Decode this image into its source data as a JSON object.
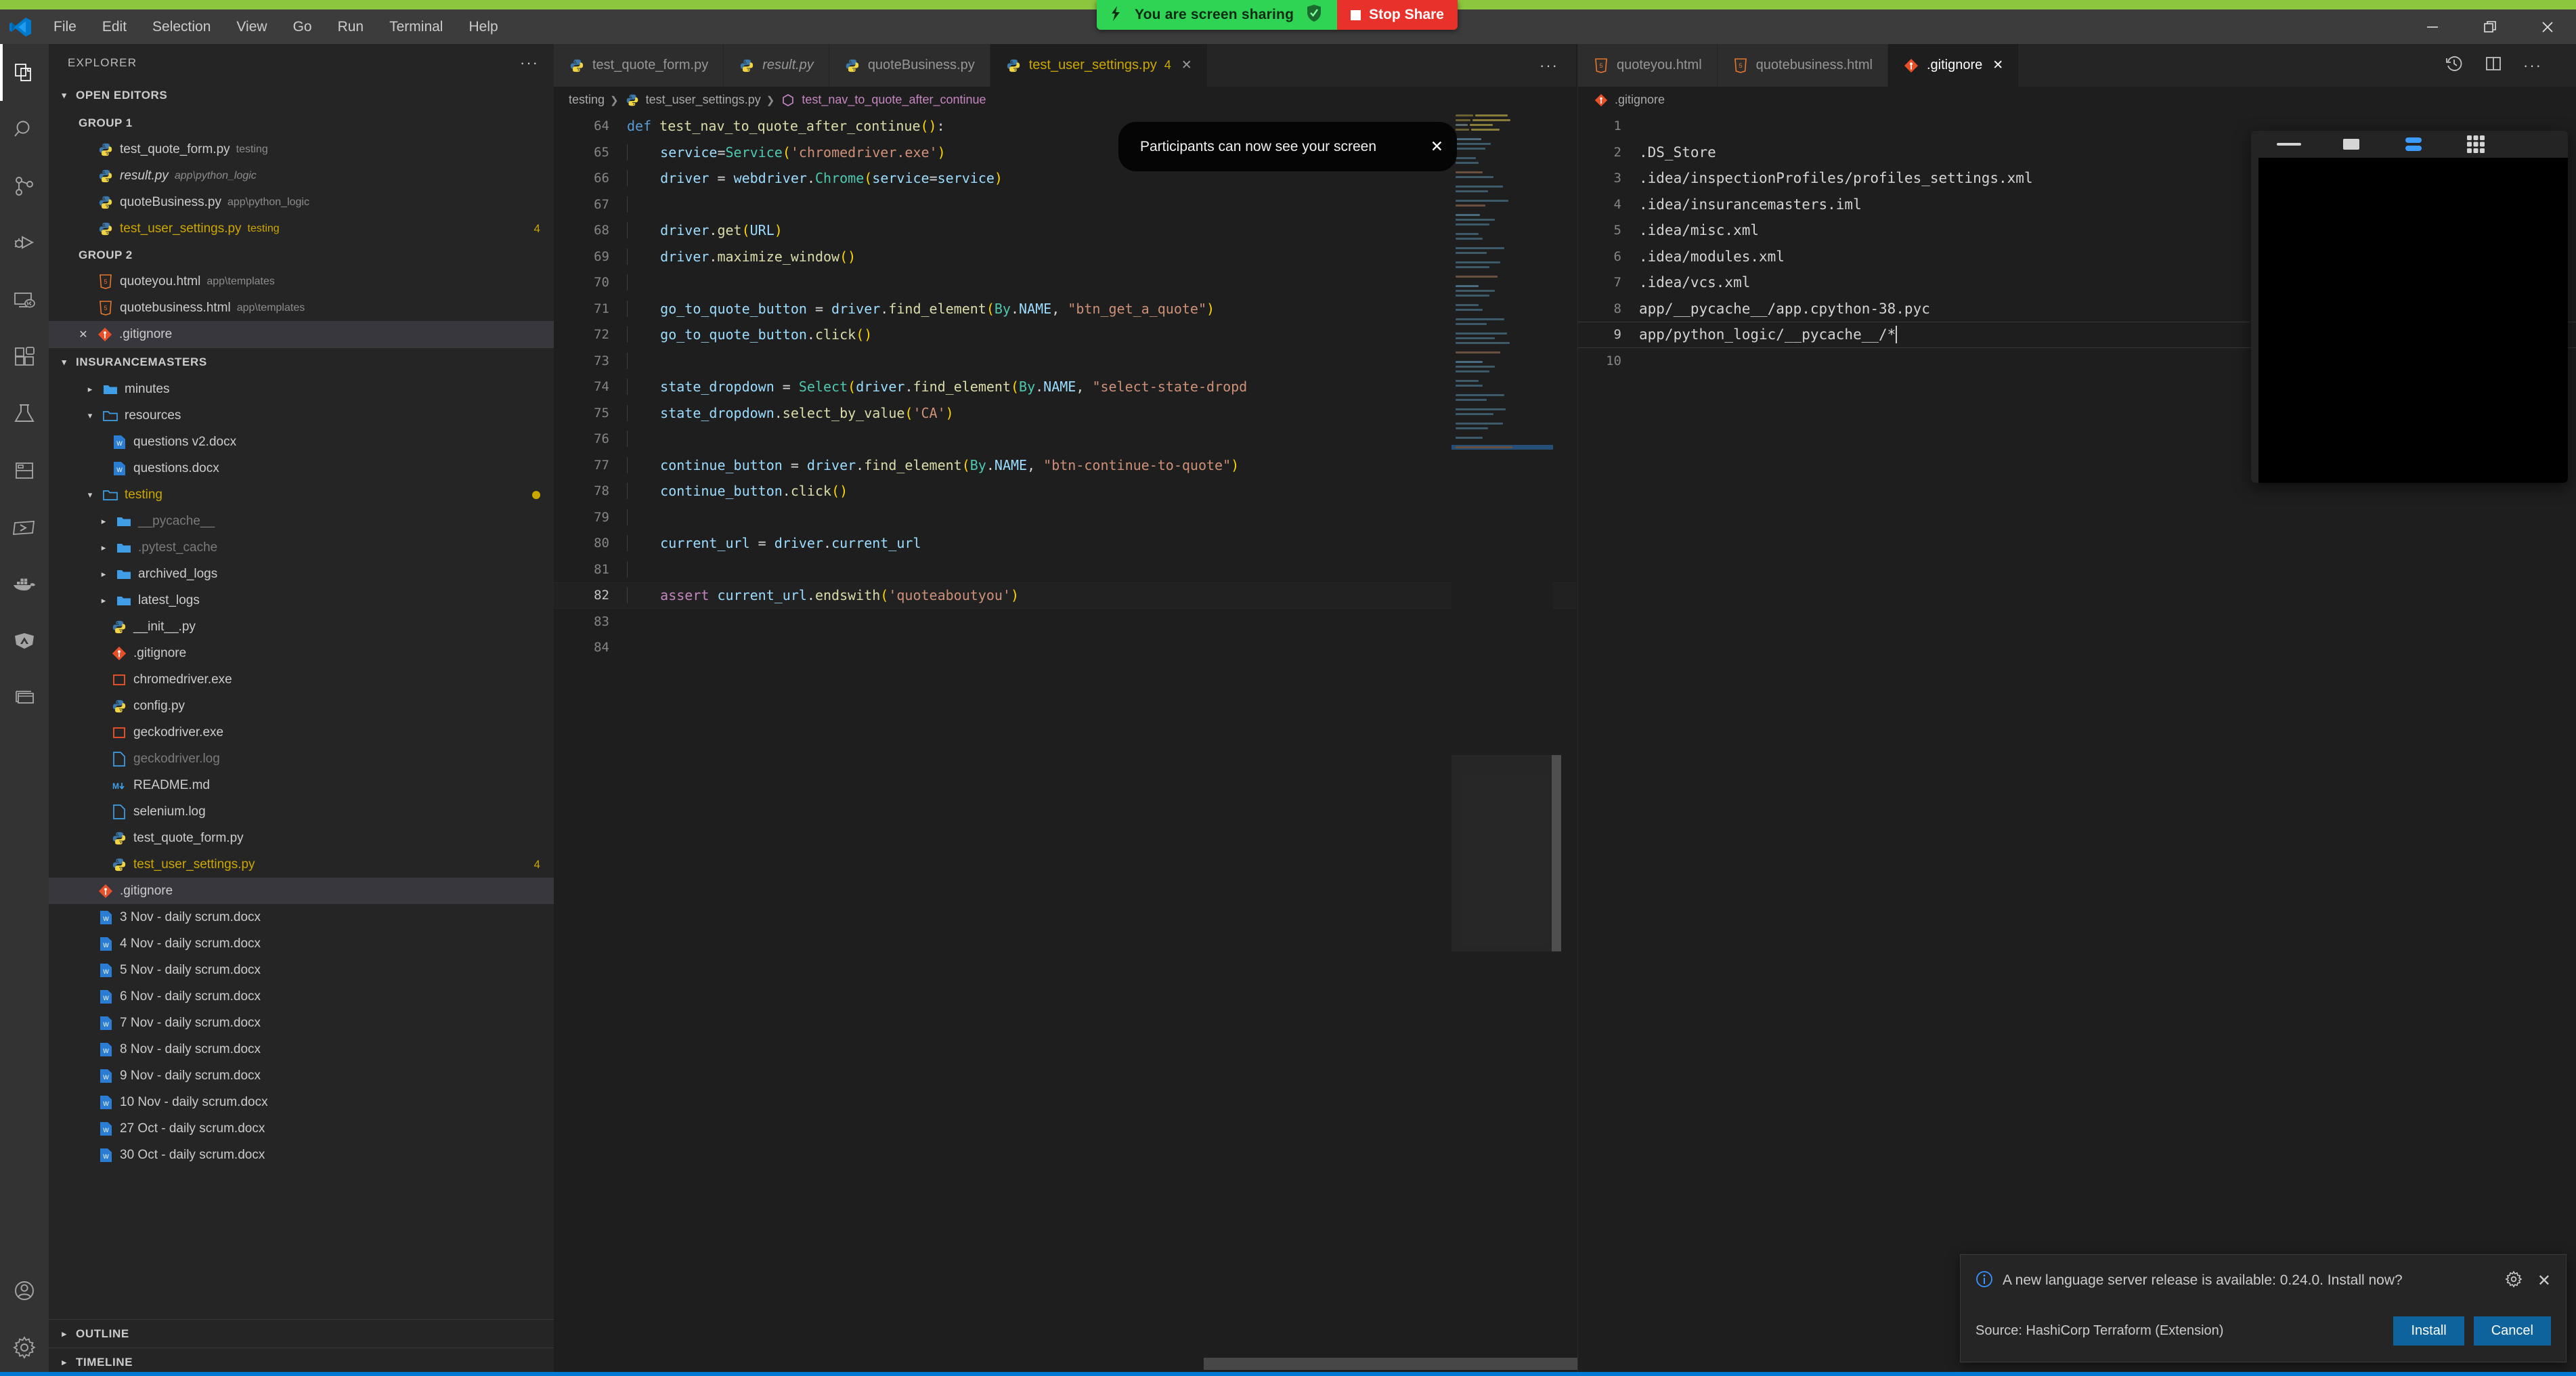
{
  "share_banner": {
    "message": "You are screen sharing",
    "stop_label": "Stop Share",
    "share_bg": "#2fd455",
    "stop_bg": "#e8312a",
    "strip_color": "#8cc63f"
  },
  "titlebar": {
    "menus": [
      "File",
      "Edit",
      "Selection",
      "View",
      "Go",
      "Run",
      "Terminal",
      "Help"
    ],
    "minimize": "—",
    "restore": "❐",
    "close": "✕"
  },
  "activity_bar": {
    "items": [
      {
        "name": "explorer",
        "icon": "files-icon",
        "active": true
      },
      {
        "name": "search",
        "icon": "search-icon",
        "active": false
      },
      {
        "name": "source-control",
        "icon": "source-control-icon",
        "active": false
      },
      {
        "name": "run-and-debug",
        "icon": "debug-icon",
        "active": false
      },
      {
        "name": "remote-explorer",
        "icon": "remote-icon",
        "active": false
      },
      {
        "name": "extensions",
        "icon": "extensions-icon",
        "active": false
      },
      {
        "name": "testing",
        "icon": "beaker-icon",
        "active": false
      },
      {
        "name": "live-server",
        "icon": "preview-icon",
        "active": false
      },
      {
        "name": "azure",
        "icon": "terminal-azure-icon",
        "active": false
      },
      {
        "name": "docker",
        "icon": "docker-icon",
        "active": false
      },
      {
        "name": "atlassian",
        "icon": "atlassian-icon",
        "active": false
      },
      {
        "name": "database",
        "icon": "database-icon",
        "active": false
      }
    ],
    "bottom": [
      {
        "name": "accounts",
        "icon": "account-icon"
      },
      {
        "name": "settings",
        "icon": "gear-icon"
      }
    ]
  },
  "sidebar": {
    "title": "EXPLORER",
    "more_label": "···",
    "open_editors": {
      "label": "OPEN EDITORS",
      "groups": [
        {
          "label": "GROUP 1",
          "items": [
            {
              "name": "test_quote_form.py",
              "desc": "testing",
              "icon": "python-icon",
              "badge": "",
              "state": ""
            },
            {
              "name": "result.py",
              "desc": "app\\python_logic",
              "icon": "python-icon",
              "badge": "",
              "state": "italic"
            },
            {
              "name": "quoteBusiness.py",
              "desc": "app\\python_logic",
              "icon": "python-icon",
              "badge": "",
              "state": ""
            },
            {
              "name": "test_user_settings.py",
              "desc": "testing",
              "icon": "python-icon",
              "badge": "4",
              "state": "warn"
            }
          ]
        },
        {
          "label": "GROUP 2",
          "items": [
            {
              "name": "quoteyou.html",
              "desc": "app\\templates",
              "icon": "html-icon",
              "badge": "",
              "state": ""
            },
            {
              "name": "quotebusiness.html",
              "desc": "app\\templates",
              "icon": "html-icon",
              "badge": "",
              "state": ""
            },
            {
              "name": ".gitignore",
              "desc": "",
              "icon": "git-icon",
              "badge": "",
              "state": "selected",
              "close": "✕"
            }
          ]
        }
      ]
    },
    "workspace": {
      "label": "INSURANCEMASTERS",
      "items": [
        {
          "name": "minutes",
          "type": "folder",
          "expanded": false,
          "indent": 1
        },
        {
          "name": "resources",
          "type": "folder-open",
          "expanded": true,
          "indent": 1
        },
        {
          "name": "questions v2.docx",
          "type": "word",
          "indent": 2
        },
        {
          "name": "questions.docx",
          "type": "word",
          "indent": 2
        },
        {
          "name": "testing",
          "type": "folder-open",
          "expanded": true,
          "indent": 1,
          "state": "warn",
          "dot": true
        },
        {
          "name": "__pycache__",
          "type": "folder",
          "expanded": false,
          "indent": 2,
          "state": "dim"
        },
        {
          "name": ".pytest_cache",
          "type": "folder",
          "expanded": false,
          "indent": 2,
          "state": "dim"
        },
        {
          "name": "archived_logs",
          "type": "folder",
          "expanded": false,
          "indent": 2
        },
        {
          "name": "latest_logs",
          "type": "folder",
          "expanded": false,
          "indent": 2
        },
        {
          "name": "__init__.py",
          "type": "python",
          "indent": 3
        },
        {
          "name": ".gitignore",
          "type": "git",
          "indent": 3
        },
        {
          "name": "chromedriver.exe",
          "type": "exe",
          "indent": 3
        },
        {
          "name": "config.py",
          "type": "python",
          "indent": 3
        },
        {
          "name": "geckodriver.exe",
          "type": "exe",
          "indent": 3
        },
        {
          "name": "geckodriver.log",
          "type": "log",
          "indent": 3,
          "state": "dim"
        },
        {
          "name": "README.md",
          "type": "markdown",
          "indent": 3
        },
        {
          "name": "selenium.log",
          "type": "log",
          "indent": 3
        },
        {
          "name": "test_quote_form.py",
          "type": "python",
          "indent": 3
        },
        {
          "name": "test_user_settings.py",
          "type": "python",
          "indent": 3,
          "state": "warn",
          "badge": "4"
        },
        {
          "name": ".gitignore",
          "type": "git",
          "indent": 2,
          "state": "selected"
        },
        {
          "name": "3 Nov - daily scrum.docx",
          "type": "word",
          "indent": 2
        },
        {
          "name": "4 Nov - daily scrum.docx",
          "type": "word",
          "indent": 2
        },
        {
          "name": "5 Nov - daily scrum.docx",
          "type": "word",
          "indent": 2
        },
        {
          "name": "6 Nov - daily scrum.docx",
          "type": "word",
          "indent": 2
        },
        {
          "name": "7 Nov - daily scrum.docx",
          "type": "word",
          "indent": 2
        },
        {
          "name": "8 Nov - daily scrum.docx",
          "type": "word",
          "indent": 2
        },
        {
          "name": "9 Nov - daily scrum.docx",
          "type": "word",
          "indent": 2
        },
        {
          "name": "10 Nov - daily scrum.docx",
          "type": "word",
          "indent": 2
        },
        {
          "name": "27 Oct - daily scrum.docx",
          "type": "word",
          "indent": 2
        },
        {
          "name": "30 Oct - daily scrum.docx",
          "type": "word",
          "indent": 2
        }
      ]
    },
    "outline_label": "OUTLINE",
    "timeline_label": "TIMELINE"
  },
  "editor_group_1": {
    "tabs": [
      {
        "label": "test_quote_form.py",
        "icon": "python-icon",
        "active": false,
        "italic": false,
        "count": "",
        "close": ""
      },
      {
        "label": "result.py",
        "icon": "python-icon",
        "active": false,
        "italic": true,
        "count": "",
        "close": ""
      },
      {
        "label": "quoteBusiness.py",
        "icon": "python-icon",
        "active": false,
        "italic": false,
        "count": "",
        "close": ""
      },
      {
        "label": "test_user_settings.py",
        "icon": "python-icon",
        "active": true,
        "italic": false,
        "count": "4",
        "close": "✕"
      }
    ],
    "more_label": "···",
    "breadcrumb": [
      "testing",
      "test_user_settings.py",
      "test_nav_to_quote_after_continue"
    ],
    "first_line_number": 64,
    "active_line": 82,
    "lines": [
      {
        "n": 64,
        "text": "def test_nav_to_quote_after_continue():"
      },
      {
        "n": 65,
        "text": "    service=Service('chromedriver.exe')"
      },
      {
        "n": 66,
        "text": "    driver = webdriver.Chrome(service=service)"
      },
      {
        "n": 67,
        "text": ""
      },
      {
        "n": 68,
        "text": "    driver.get(URL)"
      },
      {
        "n": 69,
        "text": "    driver.maximize_window()"
      },
      {
        "n": 70,
        "text": ""
      },
      {
        "n": 71,
        "text": "    go_to_quote_button = driver.find_element(By.NAME, \"btn_get_a_quote\")"
      },
      {
        "n": 72,
        "text": "    go_to_quote_button.click()"
      },
      {
        "n": 73,
        "text": ""
      },
      {
        "n": 74,
        "text": "    state_dropdown = Select(driver.find_element(By.NAME, \"select-state-dropdown\"))"
      },
      {
        "n": 75,
        "text": "    state_dropdown.select_by_value('CA')"
      },
      {
        "n": 76,
        "text": ""
      },
      {
        "n": 77,
        "text": "    continue_button = driver.find_element(By.NAME, \"btn-continue-to-quote\")"
      },
      {
        "n": 78,
        "text": "    continue_button.click()"
      },
      {
        "n": 79,
        "text": ""
      },
      {
        "n": 80,
        "text": "    current_url = driver.current_url"
      },
      {
        "n": 81,
        "text": ""
      },
      {
        "n": 82,
        "text": "    assert current_url.endswith('quoteaboutyou')"
      },
      {
        "n": 83,
        "text": ""
      },
      {
        "n": 84,
        "text": ""
      }
    ]
  },
  "tooltip": {
    "message": "Participants can now see your screen",
    "close": "✕"
  },
  "editor_group_2": {
    "tabs": [
      {
        "label": "quoteyou.html",
        "icon": "html-icon",
        "active": false,
        "close": ""
      },
      {
        "label": "quotebusiness.html",
        "icon": "html-icon",
        "active": false,
        "close": ""
      },
      {
        "label": ".gitignore",
        "icon": "git-icon",
        "active": true,
        "close": "✕"
      }
    ],
    "toolbar_icons": [
      "history-icon",
      "split-editor-icon",
      "more-actions-icon"
    ],
    "breadcrumb": [
      ".gitignore"
    ],
    "active_line": 9,
    "lines": [
      {
        "n": 1,
        "text": ""
      },
      {
        "n": 2,
        "text": ".DS_Store"
      },
      {
        "n": 3,
        "text": ".idea/inspectionProfiles/profiles_settings.xml"
      },
      {
        "n": 4,
        "text": ".idea/insurancemasters.iml"
      },
      {
        "n": 5,
        "text": ".idea/misc.xml"
      },
      {
        "n": 6,
        "text": ".idea/modules.xml"
      },
      {
        "n": 7,
        "text": ".idea/vcs.xml"
      },
      {
        "n": 8,
        "text": "app/__pycache__/app.cpython-38.pyc"
      },
      {
        "n": 9,
        "text": "app/python_logic/__pycache__/*"
      },
      {
        "n": 10,
        "text": ""
      }
    ]
  },
  "floating_share_window": {
    "controls": [
      "minimize-handle-icon",
      "window-icon",
      "layout-icon",
      "grid-view-icon"
    ],
    "video_area": "black-video-placeholder"
  },
  "notification": {
    "icon": "info-icon",
    "message": "A new language server release is available: 0.24.0. Install now?",
    "gear": "gear-icon",
    "close": "✕",
    "source": "Source: HashiCorp Terraform (Extension)",
    "install_label": "Install",
    "cancel_label": "Cancel",
    "button_color": "#0e639c"
  },
  "colors": {
    "accent": "#0078d4",
    "warning": "#cca700",
    "editor_bg": "#1e1e1e",
    "sidebar_bg": "#252526",
    "titlebar_bg": "#3c3c3c",
    "activitybar_bg": "#333333"
  }
}
